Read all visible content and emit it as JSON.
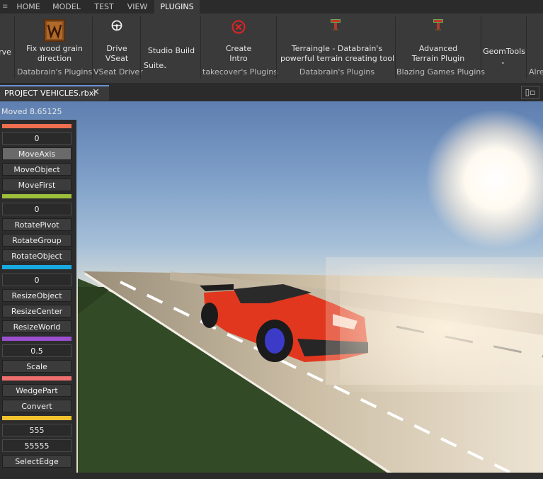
{
  "menubar": {
    "tabs": [
      {
        "label": "HOME",
        "active": false
      },
      {
        "label": "MODEL",
        "active": false
      },
      {
        "label": "TEST",
        "active": false
      },
      {
        "label": "VIEW",
        "active": false
      },
      {
        "label": "PLUGINS",
        "active": true
      }
    ]
  },
  "ribbon": {
    "cut_left_label": "rve",
    "fix_wood_line1": "Fix wood grain",
    "fix_wood_line2": "direction",
    "fix_wood_group": "Databrain's Plugins",
    "drive_line1": "Drive",
    "drive_line2": "VSeat",
    "drive_group": "VSeat Driver",
    "studio_build_line1": "Studio Build",
    "studio_build_line2": "Suite",
    "create_intro_line1": "Create",
    "create_intro_line2": "Intro",
    "create_intro_group": "takecover's Plugins",
    "terraingle_line1": "Terraingle - Databrain's",
    "terraingle_line2": "powerful terrain creating tool",
    "terraingle_group": "Databrain's Plugins",
    "advanced_terrain_line1": "Advanced",
    "advanced_terrain_line2": "Terrain Plugin",
    "advanced_terrain_group": "Blazing Games Plugins",
    "geomtools_label": "GeomTools",
    "cut_right_label": "Alre"
  },
  "document": {
    "tab_label": "PROJECT VEHICLES.rbxl",
    "close_glyph": "✕"
  },
  "viewport": {
    "status_text": "Moved 8.65125"
  },
  "panel": {
    "stripe_colors": [
      "#ee6f4f",
      "#9cbf3c",
      "#18a9e0",
      "#9b4fcf",
      "#ef6f6f",
      "#f2c12e"
    ],
    "move_value": "0",
    "move_axis": "MoveAxis",
    "move_object": "MoveObject",
    "move_first": "MoveFirst",
    "rotate_value": "0",
    "rotate_pivot": "RotatePivot",
    "rotate_group": "RotateGroup",
    "rotate_object": "RotateObject",
    "resize_value": "0",
    "resize_object": "ResizeObject",
    "resize_center": "ResizeCenter",
    "resize_world": "ResizeWorld",
    "scale_value": "0.5",
    "scale": "Scale",
    "wedge_part": "WedgePart",
    "convert": "Convert",
    "edge_value1": "555",
    "edge_value2": "55555",
    "select_edge": "SelectEdge"
  }
}
